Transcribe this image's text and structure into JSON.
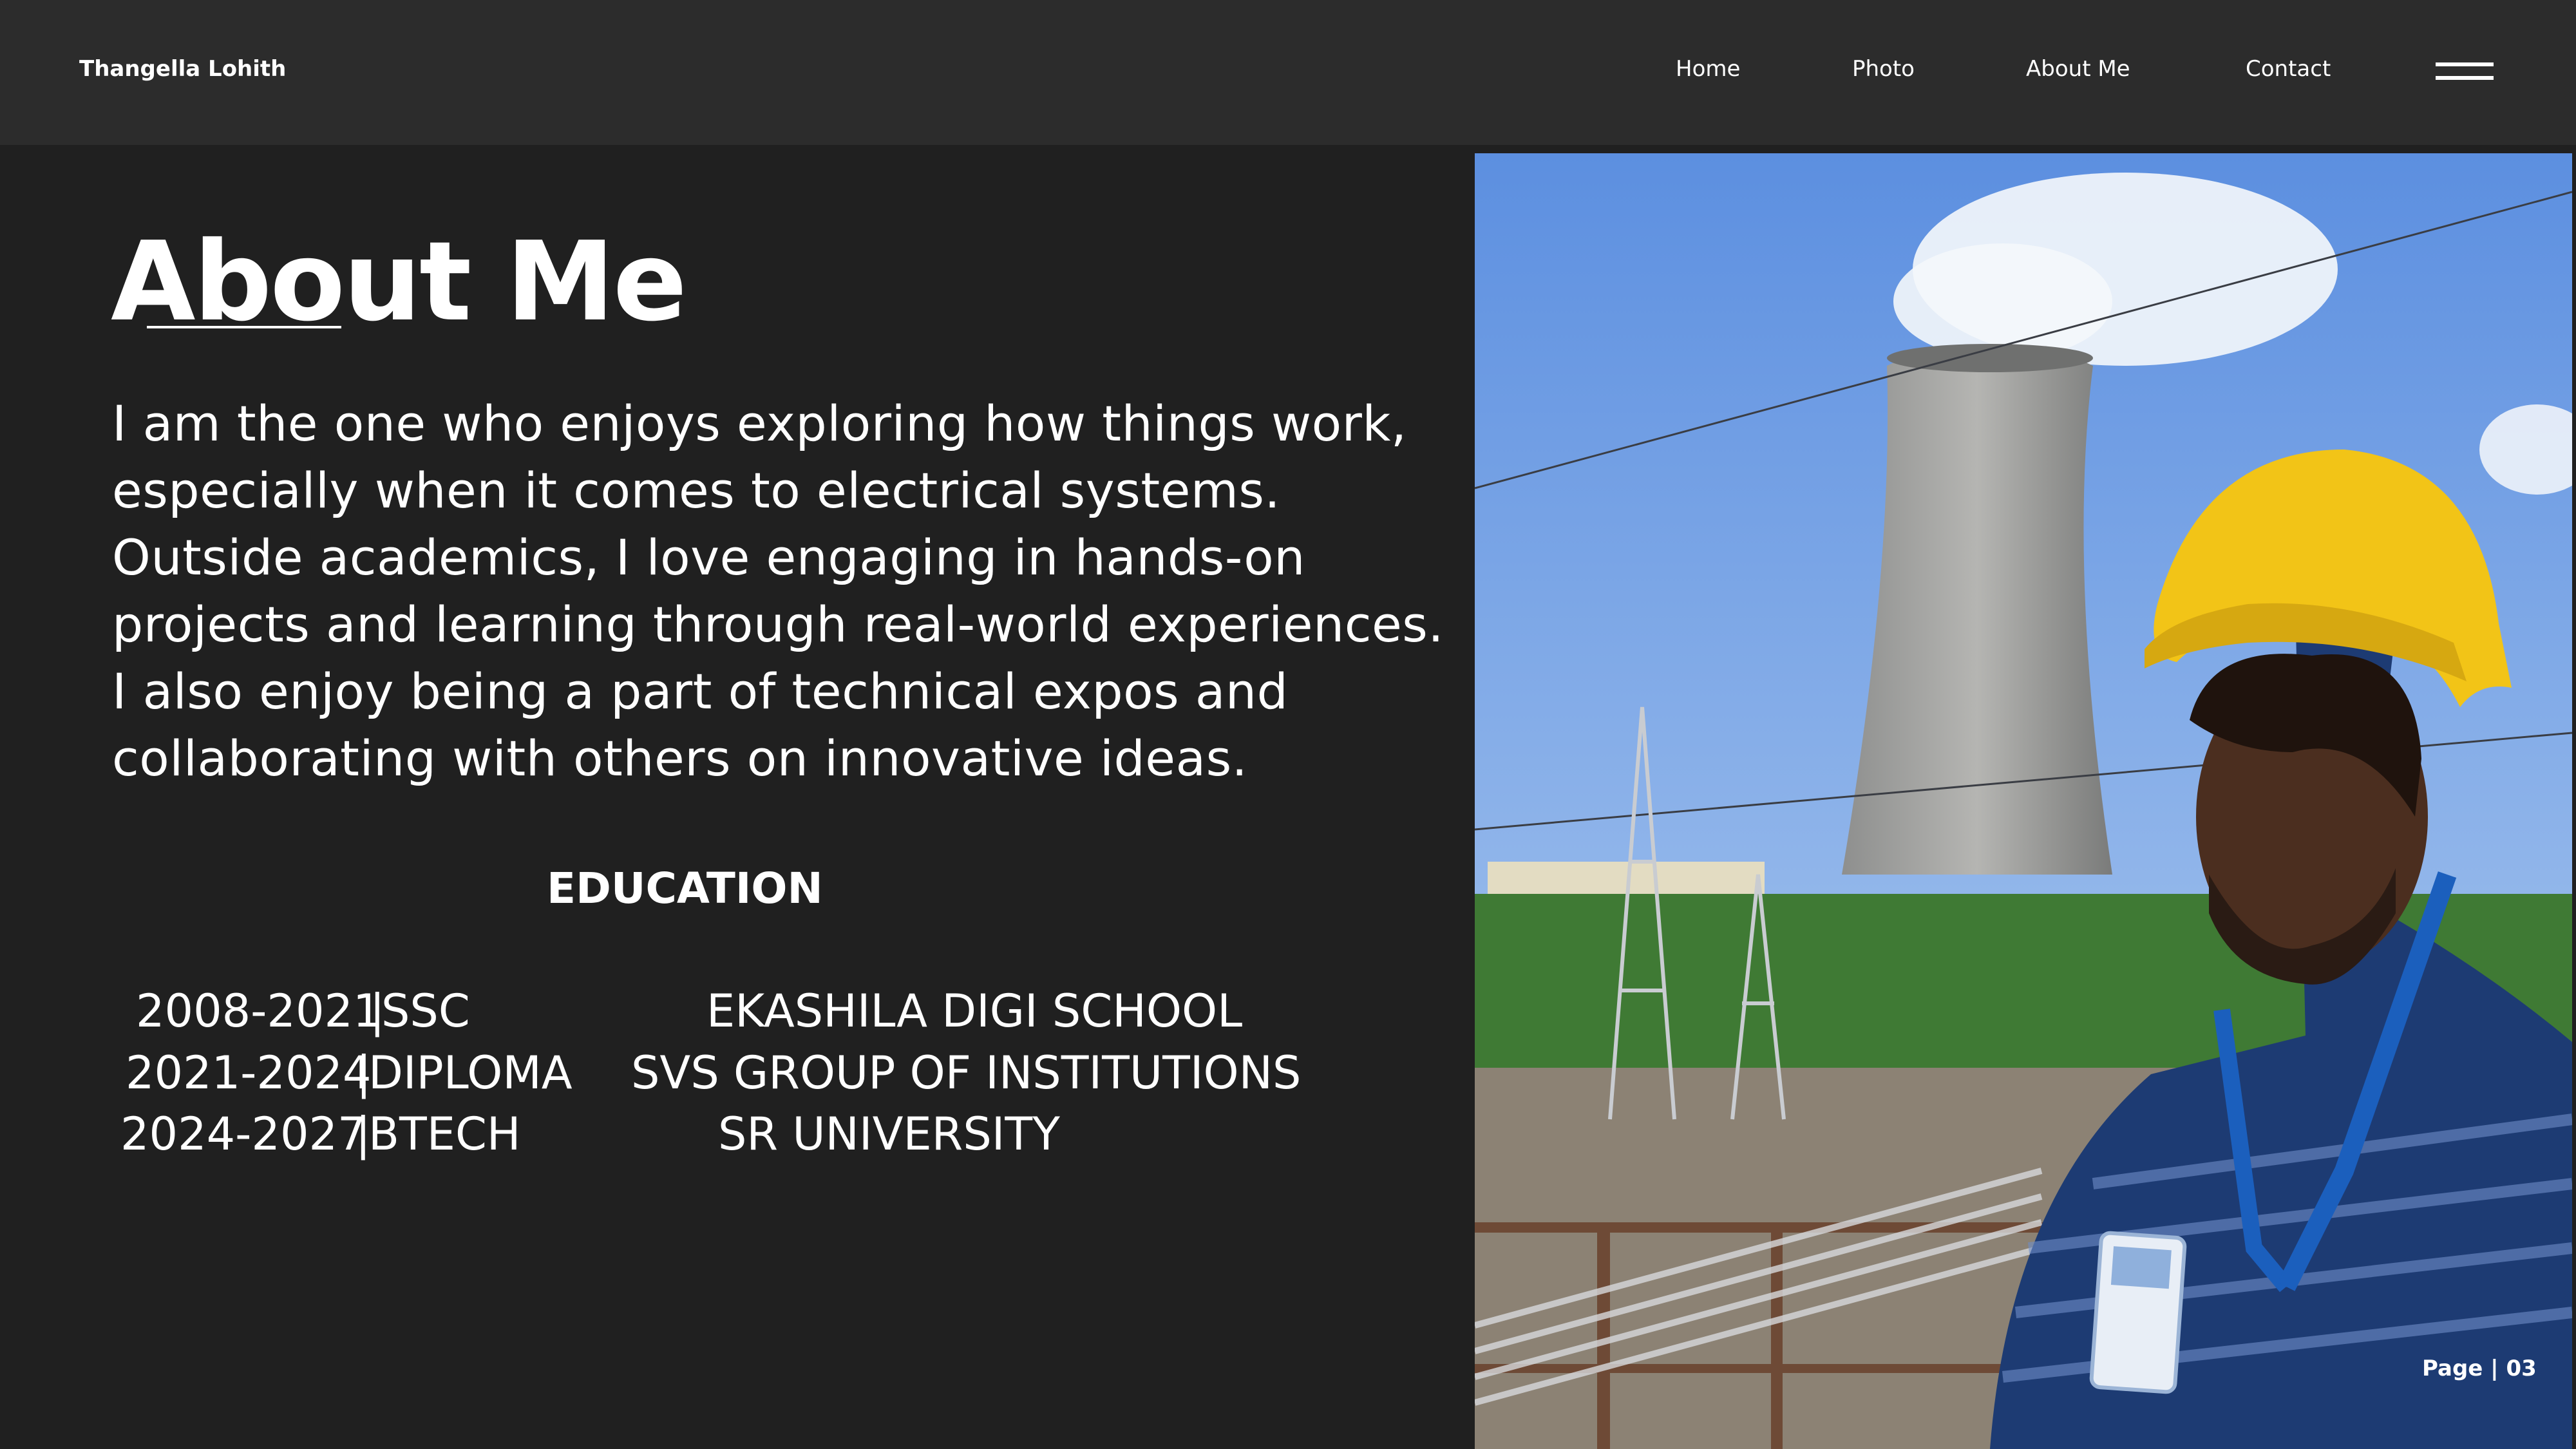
{
  "header": {
    "brand": "Thangella Lohith",
    "nav": [
      "Home",
      "Photo",
      "About Me",
      "Contact"
    ],
    "menu_icon": "hamburger-menu-icon"
  },
  "about": {
    "title": "About Me",
    "bio": "I am the one who enjoys exploring how things work, especially when it comes to electrical systems. Outside academics, I love engaging in hands-on projects and learning through real-world experiences. I also enjoy being a part of technical expos and collaborating with others on innovative ideas."
  },
  "education": {
    "heading": "EDUCATION",
    "rows": [
      {
        "years": "2008-2021",
        "level": "SSC",
        "institution": "EKASHILA DIGI SCHOOL"
      },
      {
        "years": "2021-2024",
        "level": "DIPLOMA",
        "institution": "SVS GROUP OF INSTITUTIONS"
      },
      {
        "years": "2024-2027",
        "level": "BTECH",
        "institution": "SR UNIVERSITY"
      }
    ]
  },
  "photo": {
    "icon": "profile-photo"
  },
  "footer": {
    "page": "Page | 03"
  },
  "colors": {
    "background": "#202020",
    "header": "#2c2c2c",
    "text": "#ffffff"
  }
}
